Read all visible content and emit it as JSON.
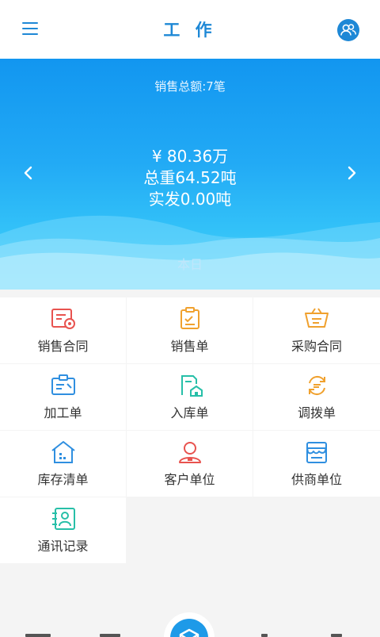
{
  "header": {
    "title": "工 作",
    "menu_icon": "hamburger-menu-icon",
    "user_icon": "user-group-icon",
    "accent": "#1e88d6"
  },
  "banner": {
    "summary": "销售总额:7笔",
    "amount": "¥ 80.36万",
    "total_weight": "总重64.52吨",
    "shipped": "实发0.00吨",
    "period": "本日",
    "prev_icon": "chevron-left-icon",
    "next_icon": "chevron-right-icon"
  },
  "menu": [
    {
      "label": "销售合同",
      "icon": "sales-contract-icon",
      "color": "#e8534f"
    },
    {
      "label": "销售单",
      "icon": "sales-order-icon",
      "color": "#f0a12e"
    },
    {
      "label": "采购合同",
      "icon": "purchase-contract-icon",
      "color": "#f0a12e"
    },
    {
      "label": "加工单",
      "icon": "processing-order-icon",
      "color": "#2f8fe0"
    },
    {
      "label": "入库单",
      "icon": "warehouse-in-icon",
      "color": "#27bfa8"
    },
    {
      "label": "调拨单",
      "icon": "transfer-order-icon",
      "color": "#f0a12e"
    },
    {
      "label": "库存清单",
      "icon": "inventory-list-icon",
      "color": "#2f8fe0"
    },
    {
      "label": "客户单位",
      "icon": "customer-icon",
      "color": "#e8534f"
    },
    {
      "label": "供商单位",
      "icon": "supplier-icon",
      "color": "#2f8fe0"
    },
    {
      "label": "通讯记录",
      "icon": "contacts-icon",
      "color": "#27bfa8"
    }
  ],
  "bottom_bar": {
    "center_icon": "mail-fab-icon"
  }
}
